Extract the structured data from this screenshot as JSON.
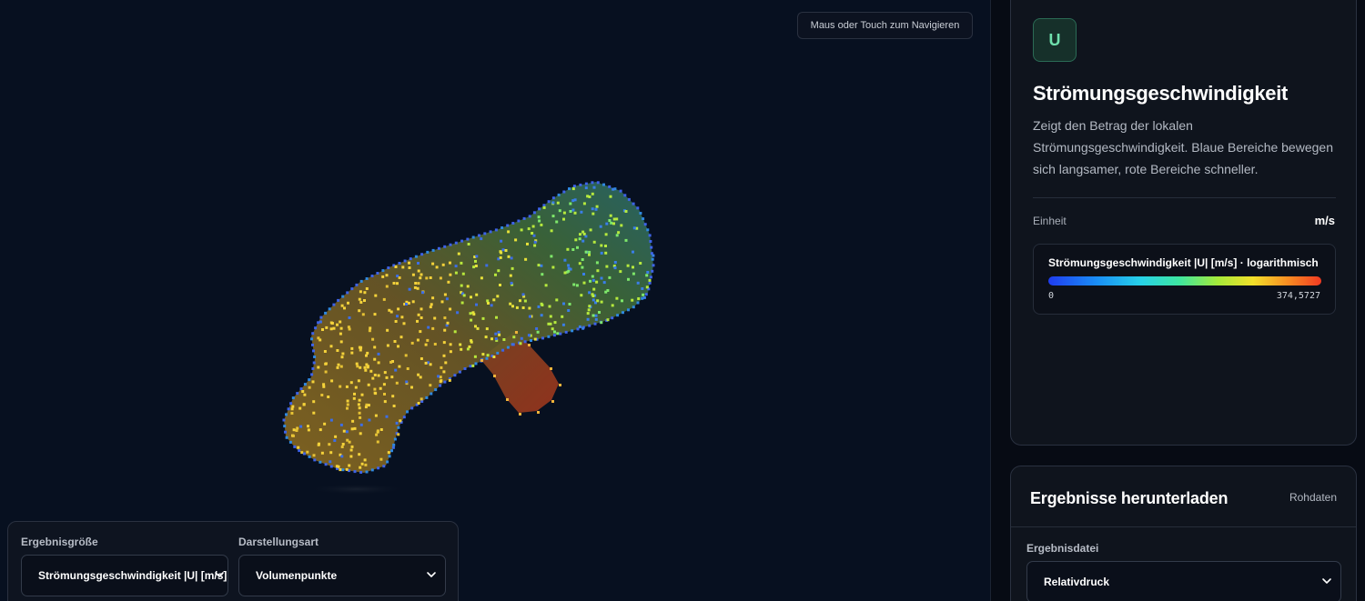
{
  "viewport": {
    "nav_hint": "Maus oder Touch zum Navigieren"
  },
  "controls": {
    "result_label": "Ergebnisgröße",
    "result_value": "Strömungsgeschwindigkeit |U| [m/s]",
    "mode_label": "Darstellungsart",
    "mode_value": "Volumenpunkte"
  },
  "info": {
    "badge": "U",
    "title": "Strömungsgeschwindigkeit",
    "description": "Zeigt den Betrag der lokalen Strömungsgeschwindigkeit. Blaue Bereiche bewegen sich langsamer, rote Bereiche schneller.",
    "unit_label": "Einheit",
    "unit_value": "m/s",
    "legend_title": "Strömungsgeschwindigkeit |U| [m/s] · logarithmisch",
    "legend_min": "0",
    "legend_max": "374,5727"
  },
  "download": {
    "title": "Ergebnisse herunterladen",
    "raw_link": "Rohdaten",
    "file_label": "Ergebnisdatei",
    "file_value": "Relativdruck"
  },
  "colors": {
    "background": "#070d1a",
    "accent_badge": "#6fe0ad"
  }
}
